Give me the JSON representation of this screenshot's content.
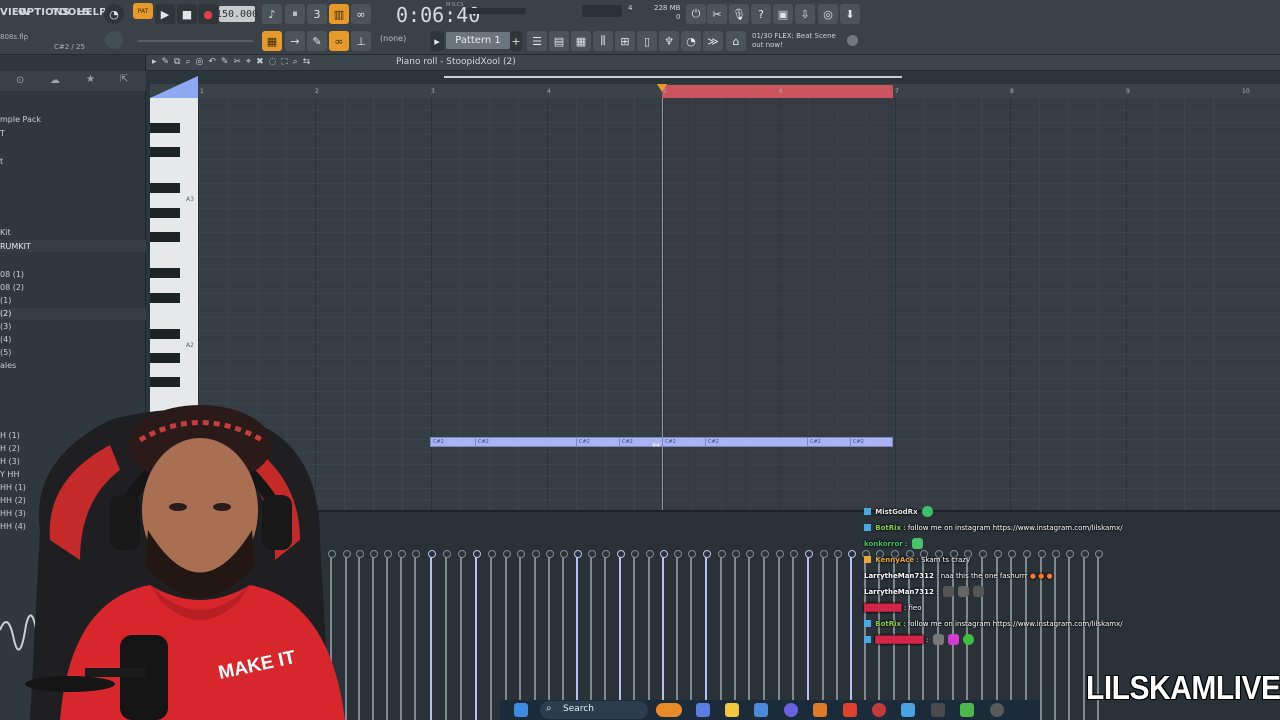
{
  "menu": [
    "VIEW",
    "OPTIONS",
    "TOOLS",
    "HELP"
  ],
  "transport": {
    "mode_label": "PAT",
    "tempo": "150.000",
    "time": "0:06:40",
    "time_unit": "M:S:CS",
    "cpu_value": "4",
    "memory": "228 MB",
    "memory_sub": "0"
  },
  "project": {
    "file_name": "808s.flp",
    "note_info": "C#2 / 25"
  },
  "pattern": {
    "none_label": "(none)",
    "name": "Pattern 1"
  },
  "news": {
    "line1": "01/30  FLEX: Beat Scene",
    "line2": "out now!"
  },
  "piano_roll": {
    "title": "Piano roll - StoopidXool (2)",
    "ruler": [
      "1",
      "2",
      "3",
      "4",
      "5",
      "6",
      "7",
      "8",
      "9",
      "10"
    ],
    "key_labels": [
      "A3",
      "A2"
    ],
    "notes": [
      "C#2",
      "C#2",
      "C#2",
      "C#2",
      "C#2",
      "C#2",
      "C#2",
      "C#2"
    ]
  },
  "browser": {
    "items": [
      {
        "label": "mple Pack"
      },
      {
        "label": "T"
      },
      {
        "label": "t"
      },
      {
        "label": "Kit"
      },
      {
        "label": "RUMKIT"
      },
      {
        "label": "08 (1)"
      },
      {
        "label": "08 (2)"
      },
      {
        "label": "(1)"
      },
      {
        "label": "(2)"
      },
      {
        "label": "(3)"
      },
      {
        "label": "(4)"
      },
      {
        "label": "(5)"
      },
      {
        "label": "ales"
      },
      {
        "label": "H (1)"
      },
      {
        "label": "H (2)"
      },
      {
        "label": "H (3)"
      },
      {
        "label": "Y HH"
      },
      {
        "label": "HH (1)"
      },
      {
        "label": "HH (2)"
      },
      {
        "label": "HH (3)"
      },
      {
        "label": "HH (4)"
      }
    ]
  },
  "chat": [
    {
      "name": "MistGodRx",
      "text": "",
      "name_color": "#e8e8e8"
    },
    {
      "name": "BotRix",
      "text": "follow me on instagram https://www.instagram.com/lilskamx/",
      "name_color": "#8bd04a"
    },
    {
      "name": "konkorror",
      "text": "",
      "name_color": "#49c36b"
    },
    {
      "name": "",
      "text": "",
      "name_color": "#d4264a"
    },
    {
      "name": "KennyAce",
      "text": "Skam ts crazy",
      "name_color": "#e6a83a"
    },
    {
      "name": "LarrytheMan7312",
      "text": "naa this the one fashurrr",
      "name_color": "#e8e8e8"
    },
    {
      "name": "LarrytheMan7312",
      "text": "",
      "name_color": "#e8e8e8"
    },
    {
      "name": "",
      "text": "fieo",
      "name_color": "#d4264a"
    },
    {
      "name": "BotRix",
      "text": "follow me on instagram https://www.instagram.com/lilskamx/",
      "name_color": "#8bd04a"
    },
    {
      "name": "",
      "text": "",
      "name_color": "#d4264a"
    }
  ],
  "webcam": {
    "shirt_text": "MAKE IT"
  },
  "taskbar": {
    "search_label": "Search"
  },
  "watermark": "LILSKAMLIVE",
  "colors": {
    "accent_orange": "#e79a2c",
    "note_blue": "#a9b5f2",
    "loop_red": "#c9545c"
  }
}
